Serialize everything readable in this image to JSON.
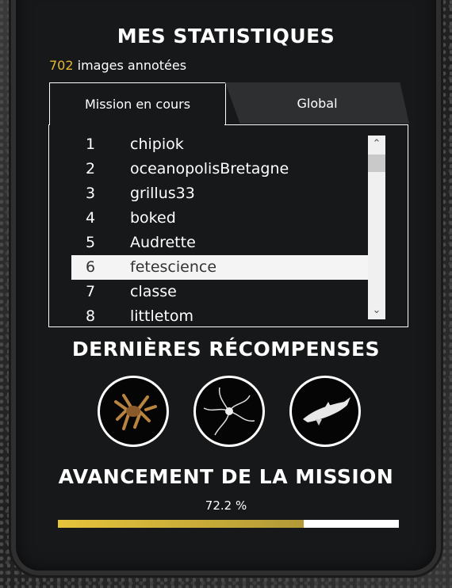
{
  "stats": {
    "title": "MES STATISTIQUES",
    "count": "702",
    "count_suffix": " images annotées"
  },
  "tabs": [
    {
      "label": "Mission en cours",
      "active": true
    },
    {
      "label": "Global",
      "active": false
    }
  ],
  "leaderboard": [
    {
      "rank": "1",
      "name": "chipiok"
    },
    {
      "rank": "2",
      "name": "oceanopolisBretagne"
    },
    {
      "rank": "3",
      "name": "grillus33"
    },
    {
      "rank": "4",
      "name": "boked"
    },
    {
      "rank": "5",
      "name": "Audrette"
    },
    {
      "rank": "6",
      "name": "fetescience",
      "highlighted": true
    },
    {
      "rank": "7",
      "name": "classe"
    },
    {
      "rank": "8",
      "name": "littletom"
    }
  ],
  "rewards": {
    "title": "DERNIÈRES RÉCOMPENSES",
    "items": [
      {
        "icon": "spider-crab-icon"
      },
      {
        "icon": "brittle-star-icon"
      },
      {
        "icon": "shark-icon"
      }
    ]
  },
  "mission": {
    "title": "AVANCEMENT DE LA MISSION",
    "progress_label": "72.2 %",
    "progress": 0.722
  },
  "colors": {
    "accent": "#e6b830",
    "panel": "#17181a",
    "highlight_row": "#f4f4f4"
  }
}
